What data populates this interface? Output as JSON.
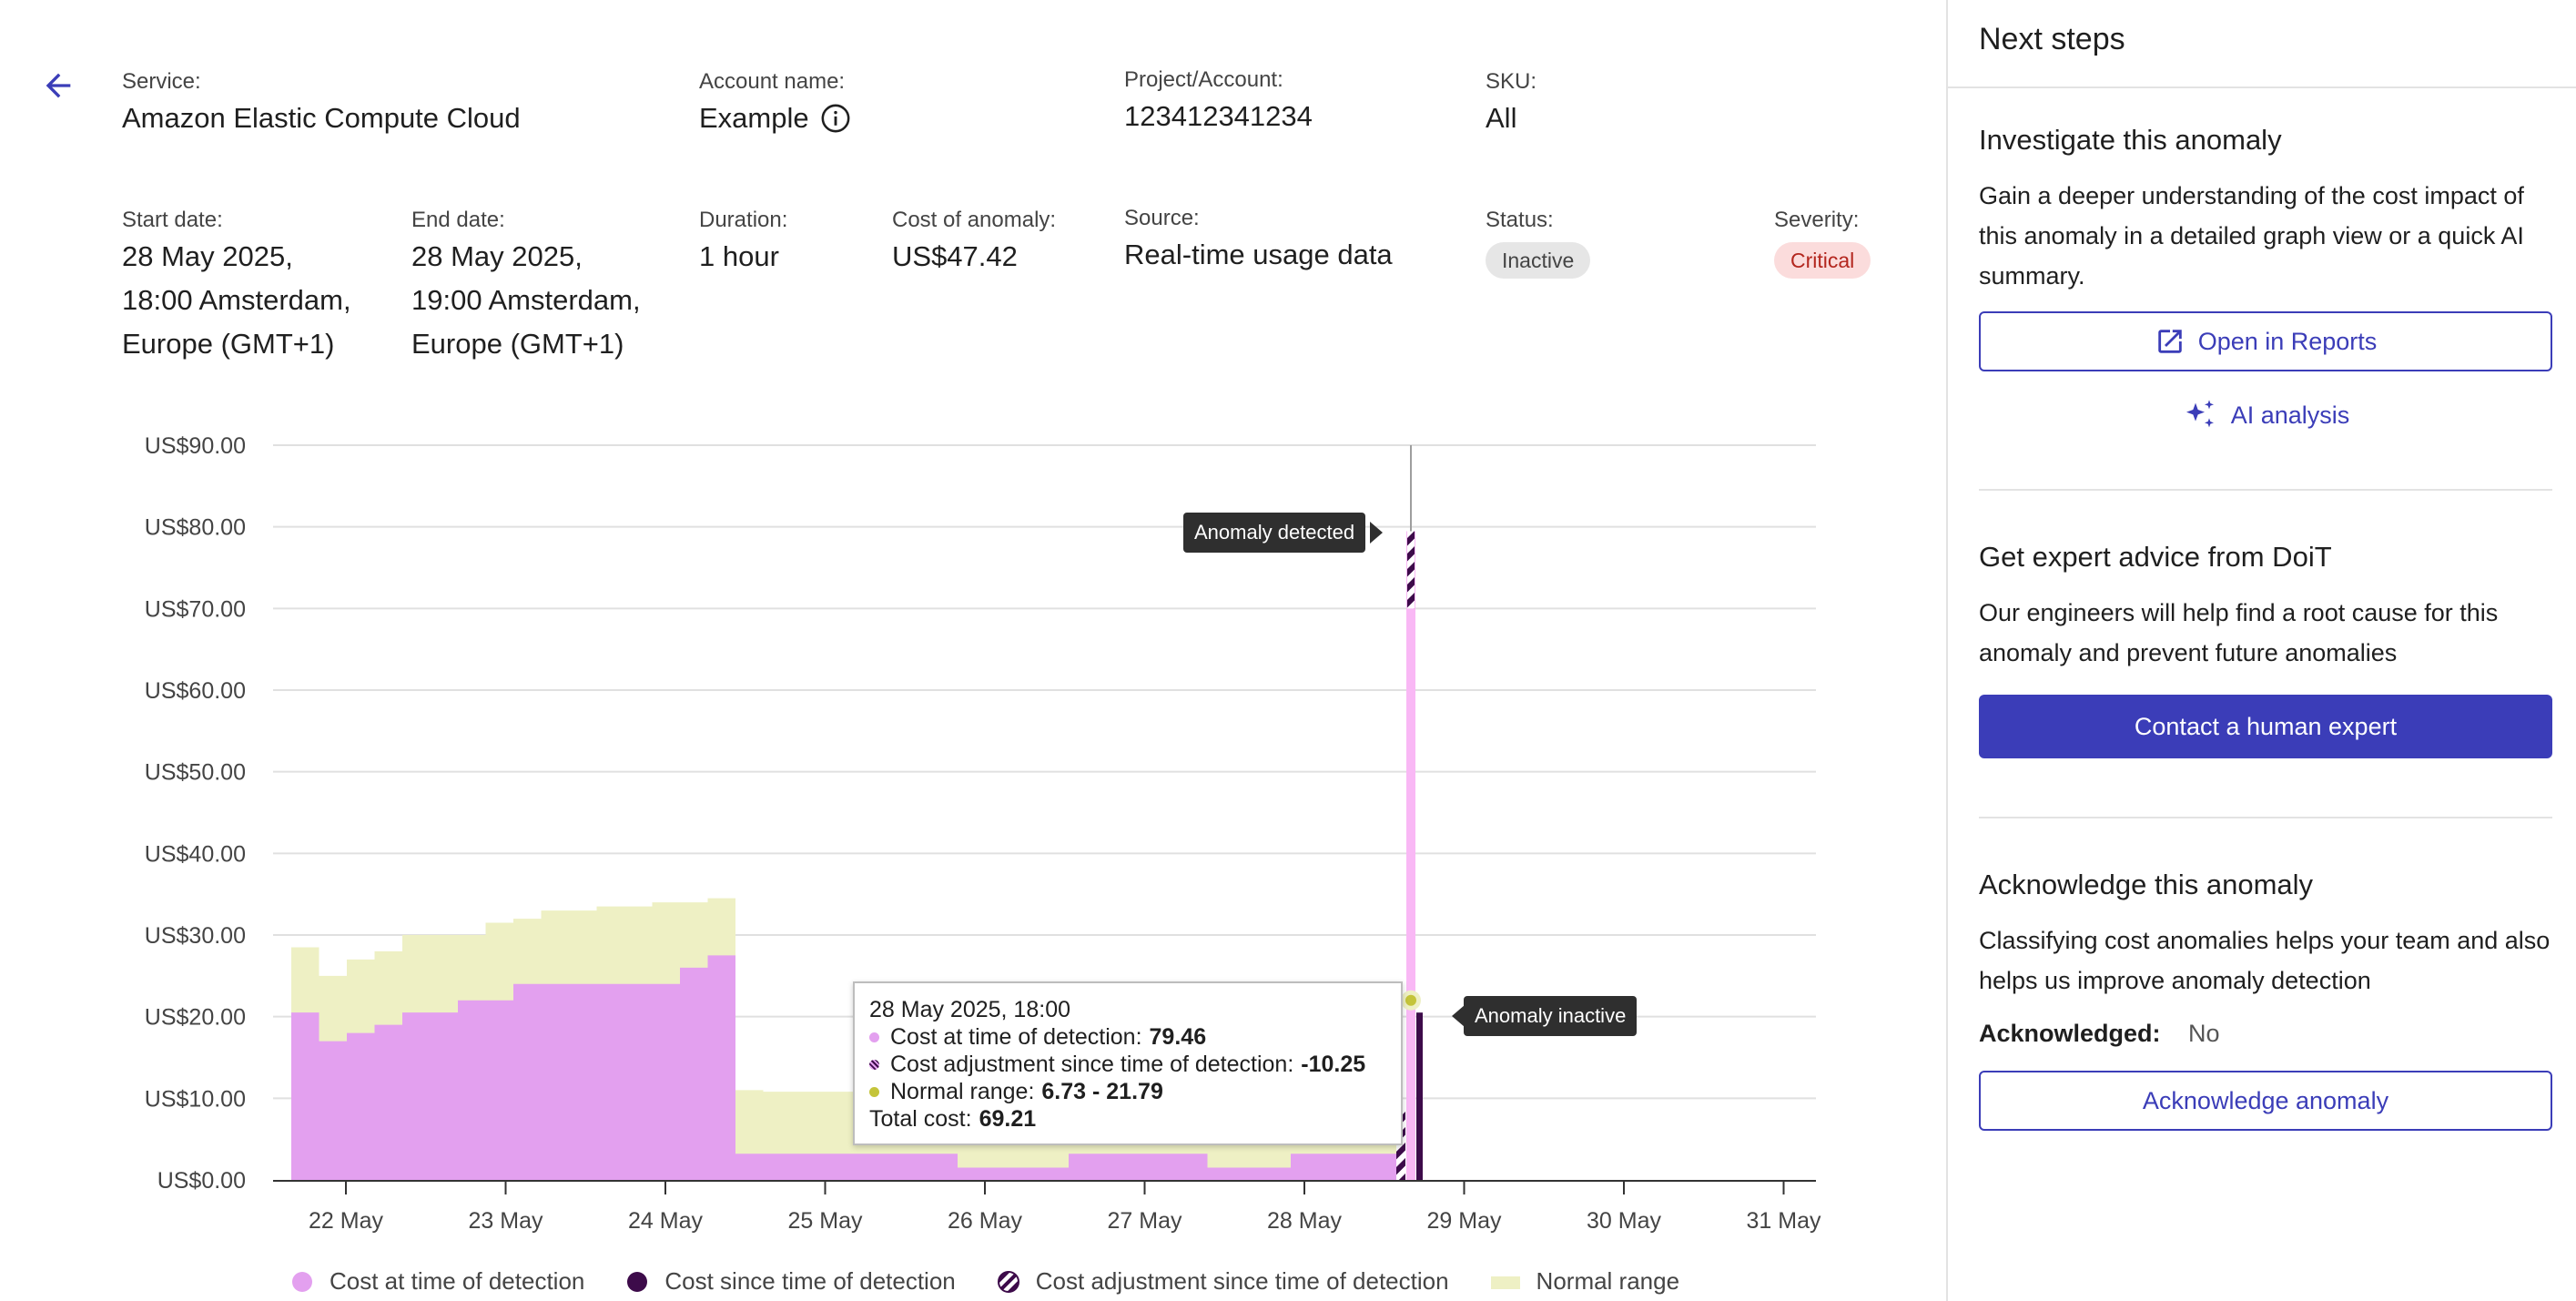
{
  "details": {
    "service_label": "Service:",
    "service_value": "Amazon Elastic Compute Cloud",
    "account_label": "Account name:",
    "account_value": "Example",
    "project_label": "Project/Account:",
    "project_value": "123412341234",
    "sku_label": "SKU:",
    "sku_value": "All",
    "start_label": "Start date:",
    "start_value_1": "28 May 2025,",
    "start_value_2": "18:00 Amsterdam,",
    "start_value_3": "Europe (GMT+1)",
    "end_label": "End date:",
    "end_value_1": "28 May 2025,",
    "end_value_2": "19:00 Amsterdam,",
    "end_value_3": "Europe (GMT+1)",
    "duration_label": "Duration:",
    "duration_value": "1 hour",
    "cost_label": "Cost of anomaly:",
    "cost_value": "US$47.42",
    "source_label": "Source:",
    "source_value": "Real-time usage data",
    "status_label": "Status:",
    "status_value": "Inactive",
    "severity_label": "Severity:",
    "severity_value": "Critical"
  },
  "chart_data": {
    "type": "area",
    "y_ticks": [
      "US$0.00",
      "US$10.00",
      "US$20.00",
      "US$30.00",
      "US$40.00",
      "US$50.00",
      "US$60.00",
      "US$70.00",
      "US$80.00",
      "US$90.00"
    ],
    "ylim": [
      0,
      90
    ],
    "x_ticks": [
      "22 May",
      "23 May",
      "24 May",
      "25 May",
      "26 May",
      "27 May",
      "28 May",
      "29 May",
      "30 May",
      "31 May"
    ],
    "series": [
      {
        "name": "Cost at time of detection",
        "color": "#e3a0ef",
        "values": [
          20.5,
          17,
          18,
          19,
          20.5,
          20.5,
          22,
          22,
          24,
          24,
          24,
          24,
          24,
          24,
          26,
          27.5,
          3.2,
          3.2,
          3.2,
          3.2,
          3.2,
          3.2,
          3.2,
          3.2,
          1.5,
          1.5,
          1.5,
          1.5,
          3.2,
          3.2,
          3.2,
          3.2,
          3.2,
          1.5,
          1.5,
          1.5,
          3.2,
          3.2,
          3.2,
          3.2
        ]
      },
      {
        "name": "Normal range",
        "color": "#eef0c4",
        "values": [
          28.5,
          25,
          27,
          28,
          30,
          30,
          30,
          31.5,
          32,
          33,
          33,
          33.5,
          33.5,
          34,
          34,
          34.5,
          11,
          10.8,
          10.8,
          10.8,
          10.8,
          11,
          10,
          11,
          10.8,
          10.8,
          10.8,
          10.8,
          10.8,
          10.8,
          10.8,
          10.8,
          10.8,
          10.8,
          10.8,
          10.8,
          10.8,
          10.8,
          22,
          22
        ]
      },
      {
        "name": "Cost since time of detection",
        "color": "#3d0b4a",
        "values": [
          20.5
        ]
      },
      {
        "name": "Cost adjustment since time of detection",
        "color": "#3d0b4a",
        "values": [
          79.46
        ]
      }
    ],
    "annotations": [
      "Anomaly detected",
      "Anomaly inactive"
    ],
    "tooltip": {
      "title": "28 May 2025, 18:00",
      "l1": "Cost at time of detection:",
      "v1": "79.46",
      "l2": "Cost adjustment since time of detection:",
      "v2": "-10.25",
      "l3": "Normal range:",
      "v3": "6.73 - 21.79",
      "l4": "Total cost:",
      "v4": "69.21"
    },
    "legend_position": "bottom"
  },
  "legend": {
    "cost_at_detection": "Cost at time of detection",
    "cost_since_detection": "Cost since time of detection",
    "cost_adjustment": "Cost adjustment since time of detection",
    "normal_range": "Normal range"
  },
  "panel": {
    "title": "Next steps",
    "investigate_title": "Investigate this anomaly",
    "investigate_text": "Gain a deeper understanding of the cost impact of this anomaly in a detailed graph view or a quick AI summary.",
    "open_reports": "Open in Reports",
    "ai_analysis": "AI analysis",
    "expert_title": "Get expert advice from DoiT",
    "expert_text": "Our engineers will help find a root cause for this anomaly and prevent future anomalies",
    "contact_expert": "Contact a human expert",
    "ack_title": "Acknowledge this anomaly",
    "ack_text": "Classifying cost anomalies helps your team and also helps us improve anomaly detection",
    "ack_label": "Acknowledged:",
    "ack_value": "No",
    "ack_button": "Acknowledge anomaly"
  },
  "colors": {
    "accent": "#3b3db8",
    "cost_at_detection": "#e3a0ef",
    "normal_range": "#eef0c4",
    "cost_since": "#3d0b4a",
    "spike": "#f9b8f5"
  }
}
